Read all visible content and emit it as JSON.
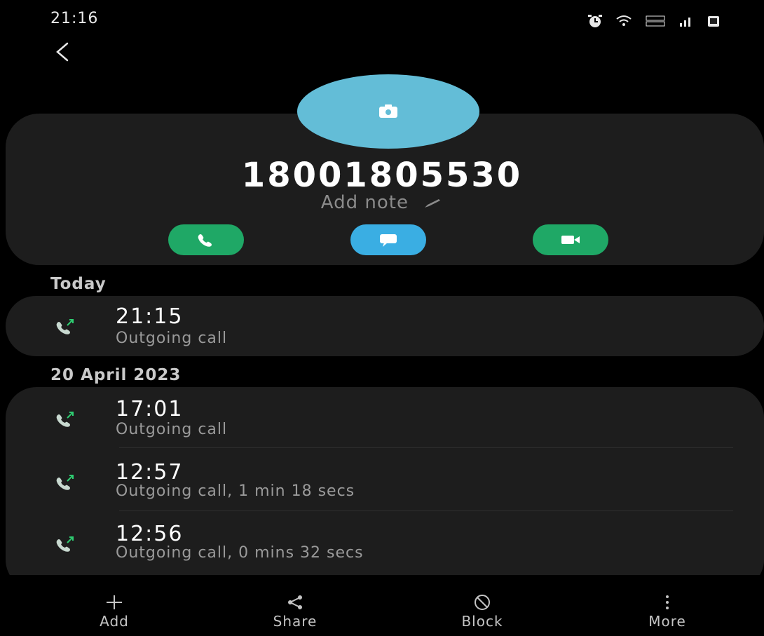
{
  "status_bar": {
    "time": "21:16",
    "icons": [
      "alarm-icon",
      "wifi-icon",
      "volte-icon",
      "signal-icon",
      "battery-icon"
    ]
  },
  "contact": {
    "number": "18001805530",
    "add_note_label": "Add note"
  },
  "actions": [
    {
      "name": "call",
      "icon": "phone-icon",
      "color": "#1fa866"
    },
    {
      "name": "message",
      "icon": "message-icon",
      "color": "#3aaee3"
    },
    {
      "name": "video",
      "icon": "video-icon",
      "color": "#1fa866"
    }
  ],
  "call_log": [
    {
      "date_label": "Today",
      "calls": [
        {
          "time": "21:15",
          "detail": "Outgoing call"
        }
      ]
    },
    {
      "date_label": "20 April 2023",
      "calls": [
        {
          "time": "17:01",
          "detail": "Outgoing call"
        },
        {
          "time": "12:57",
          "detail": "Outgoing call, 1 min 18 secs"
        },
        {
          "time": "12:56",
          "detail": "Outgoing call, 0 mins 32 secs"
        }
      ]
    }
  ],
  "bottom_nav": [
    {
      "label": "Add",
      "icon": "plus-icon"
    },
    {
      "label": "Share",
      "icon": "share-icon"
    },
    {
      "label": "Block",
      "icon": "block-icon"
    },
    {
      "label": "More",
      "icon": "more-vertical-icon"
    }
  ],
  "colors": {
    "background": "#000000",
    "card": "#1d1d1d",
    "avatar": "#63bdd7",
    "call_green": "#1fa866",
    "message_blue": "#3aaee3",
    "outgoing_arrow": "#2ecc71"
  }
}
